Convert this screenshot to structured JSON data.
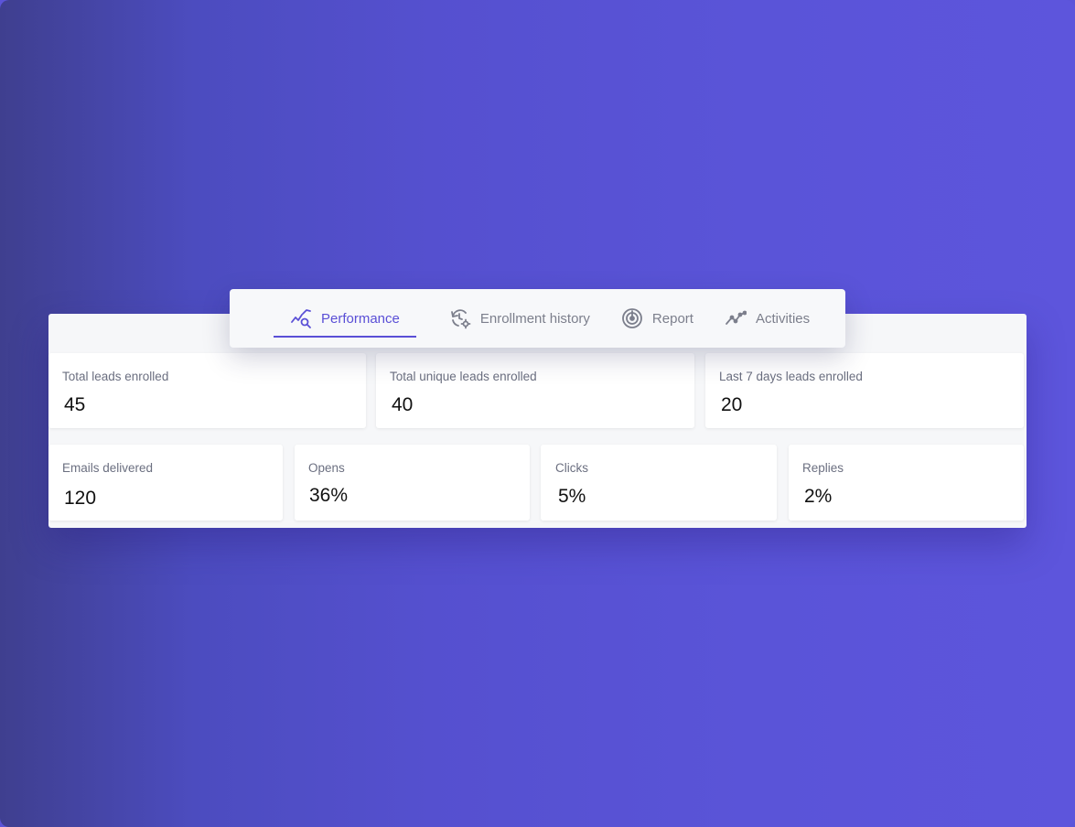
{
  "tabs": [
    {
      "label": "Performance",
      "icon": "performance-chart-icon",
      "active": true
    },
    {
      "label": "Enrollment history",
      "icon": "history-gear-icon",
      "active": false
    },
    {
      "label": "Report",
      "icon": "target-icon",
      "active": false
    },
    {
      "label": "Activities",
      "icon": "activity-line-icon",
      "active": false
    }
  ],
  "stats_top": [
    {
      "label": "Total leads enrolled",
      "value": "45"
    },
    {
      "label": "Total unique leads enrolled",
      "value": "40"
    },
    {
      "label": "Last 7 days leads enrolled",
      "value": "20"
    }
  ],
  "stats_bottom": [
    {
      "label": "Emails delivered",
      "value": "120"
    },
    {
      "label": "Opens",
      "value": "36%"
    },
    {
      "label": "Clicks",
      "value": "5%"
    },
    {
      "label": "Replies",
      "value": "2%"
    }
  ],
  "colors": {
    "accent": "#5a4fd6",
    "background_start": "#3f3f8f",
    "background_end": "#5d55dc"
  }
}
